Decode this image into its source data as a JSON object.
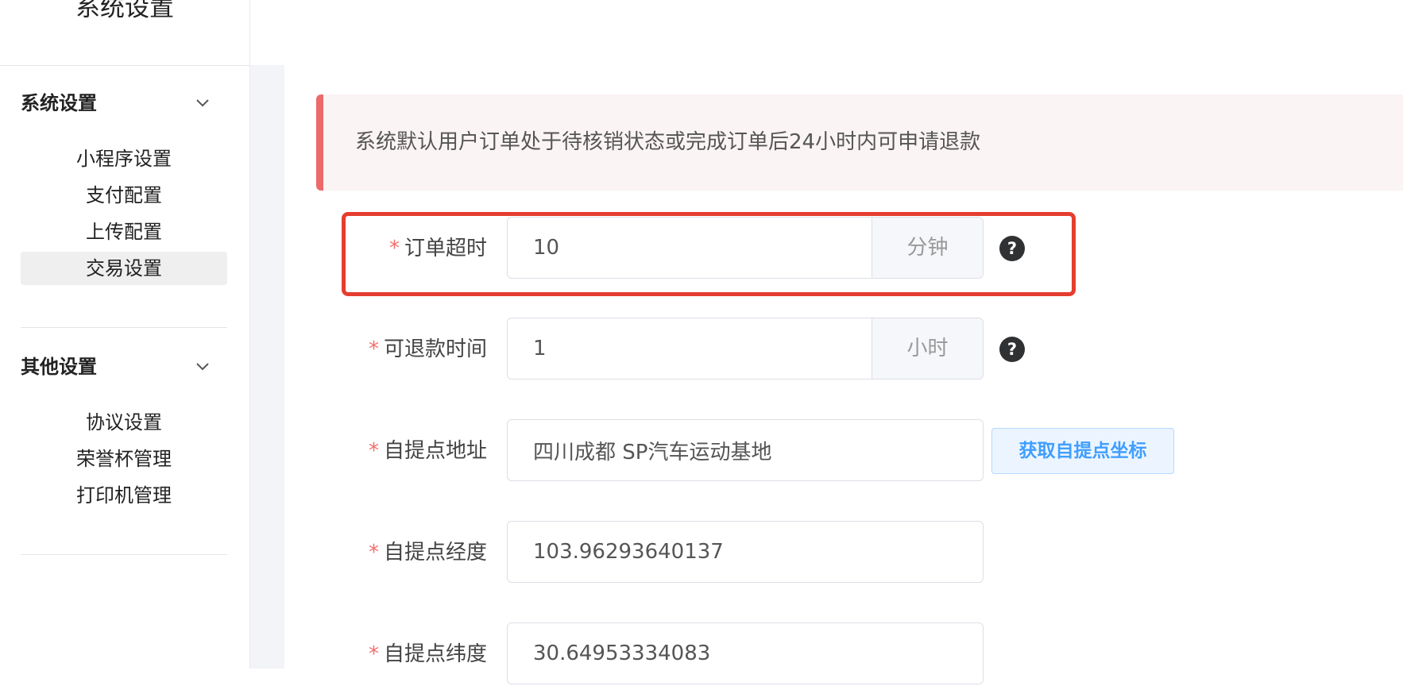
{
  "sidebar": {
    "title": "系统设置",
    "groups": [
      {
        "label": "系统设置",
        "items": [
          {
            "label": "小程序设置",
            "active": false
          },
          {
            "label": "支付配置",
            "active": false
          },
          {
            "label": "上传配置",
            "active": false
          },
          {
            "label": "交易设置",
            "active": true
          }
        ]
      },
      {
        "label": "其他设置",
        "items": [
          {
            "label": "协议设置",
            "active": false
          },
          {
            "label": "荣誉杯管理",
            "active": false
          },
          {
            "label": "打印机管理",
            "active": false
          }
        ]
      }
    ]
  },
  "alert": {
    "text": "系统默认用户订单处于待核销状态或完成订单后24小时内可申请退款",
    "accent_color": "#ec6a6a"
  },
  "form": {
    "required_mark": "*",
    "order_timeout": {
      "label": "订单超时",
      "value": "10",
      "suffix": "分钟",
      "help_icon": "question-circle-icon"
    },
    "refund_time": {
      "label": "可退款时间",
      "value": "1",
      "suffix": "小时",
      "help_icon": "question-circle-icon"
    },
    "pickup_address": {
      "label": "自提点地址",
      "value": "四川成都 SP汽车运动基地",
      "button_label": "获取自提点坐标"
    },
    "pickup_longitude": {
      "label": "自提点经度",
      "value": "103.96293640137"
    },
    "pickup_latitude": {
      "label": "自提点纬度",
      "value": "30.64953334083"
    }
  },
  "colors": {
    "required": "#f56c6c",
    "highlight_border": "#e53d2f",
    "primary_button_text": "#409eff"
  }
}
